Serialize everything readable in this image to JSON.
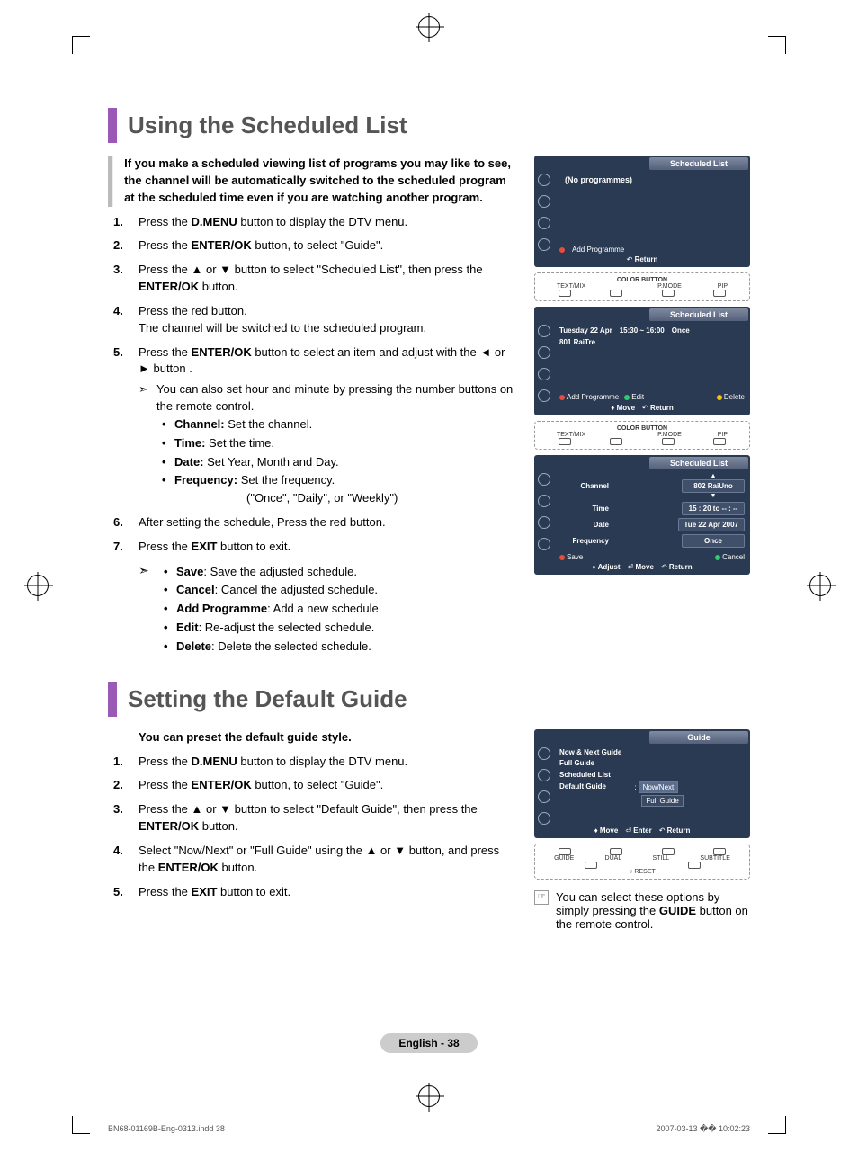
{
  "section1": {
    "title": "Using the Scheduled List",
    "intro": "If you make a scheduled viewing list of programs you may like to see, the channel will be automatically switched to the scheduled program at the scheduled time even if you are watching another program.",
    "steps": {
      "s1": {
        "pre": "Press the ",
        "b1": "D.MENU",
        "post": " button to display the DTV menu."
      },
      "s2": {
        "pre": "Press the ",
        "b1": "ENTER/OK",
        "post": " button, to select \"Guide\"."
      },
      "s3": {
        "pre": "Press the ▲ or ▼ button to select \"Scheduled List\", then press the ",
        "b1": "ENTER/OK",
        "post": " button."
      },
      "s4": {
        "line1": "Press the red button.",
        "line2": "The channel will be switched to the scheduled program."
      },
      "s5": {
        "pre": "Press the ",
        "b1": "ENTER/OK",
        "mid": " button to select an item and adjust with the ◄ or ► button .",
        "sub1": "You can also set hour and minute by pressing the number buttons on the remote control.",
        "b_channel": "Channel:",
        "t_channel": " Set the channel.",
        "b_time": "Time:",
        "t_time": " Set the time.",
        "b_date": "Date:",
        "t_date": " Set Year, Month and Day.",
        "b_freq": "Frequency:",
        "t_freq": " Set the frequency.",
        "t_freq2": "(\"Once\", \"Daily\", or \"Weekly\")"
      },
      "s6": "After setting the schedule, Press the red button.",
      "s7": {
        "pre": "Press the ",
        "b1": "EXIT",
        "post": " button to exit."
      }
    },
    "hints": {
      "b_save": "Save",
      "t_save": ": Save the adjusted schedule.",
      "b_cancel": "Cancel",
      "t_cancel": ": Cancel the adjusted schedule.",
      "b_add": "Add Programme",
      "t_add": ": Add a new schedule.",
      "b_edit": "Edit",
      "t_edit": ": Re-adjust the selected schedule.",
      "b_delete": "Delete",
      "t_delete": ": Delete the selected schedule."
    }
  },
  "osd1": {
    "title": "Scheduled List",
    "msg": "(No programmes)",
    "add": "Add Programme",
    "return": "Return"
  },
  "remote1": {
    "color_button": "COLOR BUTTON",
    "textmix": "TEXT/MIX",
    "pmode": "P.MODE",
    "pip": "PIP"
  },
  "osd2": {
    "title": "Scheduled List",
    "row_date": "Tuesday  22  Apr",
    "row_time": "15:30 ~ 16:00",
    "row_once": "Once",
    "row_ch": "801  RaiTre",
    "add": "Add Programme",
    "edit": "Edit",
    "delete": "Delete",
    "move": "Move",
    "return": "Return"
  },
  "osd3": {
    "title": "Scheduled List",
    "lbl_channel": "Channel",
    "val_channel": "802 RaiUno",
    "lbl_time": "Time",
    "val_time": "15 : 20 to -- : --",
    "lbl_date": "Date",
    "val_date": "Tue 22 Apr 2007",
    "lbl_freq": "Frequency",
    "val_freq": "Once",
    "save": "Save",
    "cancel": "Cancel",
    "adjust": "Adjust",
    "move": "Move",
    "return": "Return"
  },
  "section2": {
    "title": "Setting the Default Guide",
    "intro": "You can preset the default guide style.",
    "steps": {
      "s1": {
        "pre": "Press the ",
        "b1": "D.MENU",
        "post": " button to display the DTV menu."
      },
      "s2": {
        "pre": "Press the ",
        "b1": "ENTER/OK",
        "post": " button, to select \"Guide\"."
      },
      "s3": {
        "pre": "Press the ▲ or ▼ button to select \"Default Guide\", then press the ",
        "b1": "ENTER/OK",
        "post": " button."
      },
      "s4": {
        "pre": "Select \"Now/Next\" or \"Full Guide\" using the ▲ or ▼ button, and press the ",
        "b1": "ENTER/OK",
        "post": " button."
      },
      "s5": {
        "pre": "Press the ",
        "b1": "EXIT",
        "post": " button to exit."
      }
    },
    "note": {
      "pre": "You can select these options by simply pressing the ",
      "b1": "GUIDE",
      "post": " button on the remote control."
    }
  },
  "osd4": {
    "title": "Guide",
    "item1": "Now & Next Guide",
    "item2": "Full Guide",
    "item3": "Scheduled List",
    "item4": "Default Guide",
    "colon": ":",
    "opt1": "Now/Next",
    "opt2": "Full Guide",
    "move": "Move",
    "enter": "Enter",
    "return": "Return"
  },
  "remote2": {
    "guide": "GUIDE",
    "dual": "DUAL",
    "still": "STILL",
    "subtitle": "SUBTITLE",
    "reset": "RESET"
  },
  "footer": {
    "page": "English - 38",
    "left": "BN68-01169B-Eng-0313.indd   38",
    "right": "2007-03-13   �� 10:02:23"
  }
}
